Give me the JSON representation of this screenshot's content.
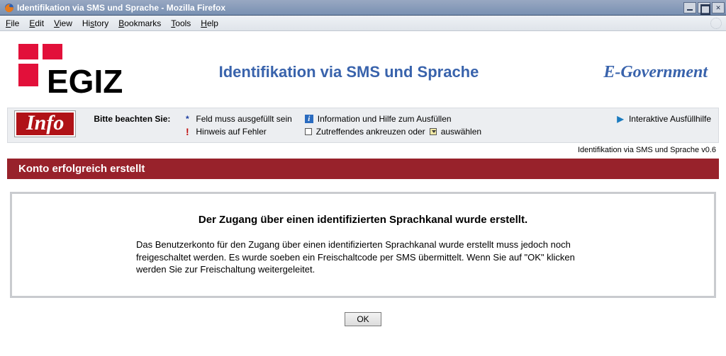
{
  "window": {
    "title": "Identifikation via SMS und Sprache - Mozilla Firefox"
  },
  "menu": {
    "file": {
      "label": "File",
      "ukey": "F"
    },
    "edit": {
      "label": "Edit",
      "ukey": "E"
    },
    "view": {
      "label": "View",
      "ukey": "V"
    },
    "history": {
      "label": "History",
      "ukey": "s"
    },
    "bookmarks": {
      "label": "Bookmarks",
      "ukey": "B"
    },
    "tools": {
      "label": "Tools",
      "ukey": "T"
    },
    "help": {
      "label": "Help",
      "ukey": "H"
    }
  },
  "header": {
    "logo_text": "EGIZ",
    "title": "Identifikation via SMS und Sprache",
    "egov": "E-Government"
  },
  "legend": {
    "badge": "Info",
    "label": "Bitte beachten Sie:",
    "required": "Feld muss ausgefüllt sein",
    "error": "Hinweis auf Fehler",
    "info": "Information und Hilfe zum Ausfüllen",
    "check_pre": "Zutreffendes ankreuzen oder",
    "check_post": "auswählen",
    "interactive": "Interaktive Ausfüllhilfe"
  },
  "version_line": "Identifikation via SMS und Sprache v0.6",
  "banner": "Konto erfolgreich erstellt",
  "panel": {
    "heading": "Der Zugang über einen identifizierten Sprachkanal wurde erstellt.",
    "body": "Das Benutzerkonto für den Zugang über einen identifizierten Sprachkanal wurde erstellt muss jedoch noch freigeschaltet werden. Es wurde soeben ein Freischaltcode per SMS übermittelt. Wenn Sie auf \"OK\" klicken werden Sie zur Freischaltung weitergeleitet."
  },
  "buttons": {
    "ok": "OK"
  }
}
